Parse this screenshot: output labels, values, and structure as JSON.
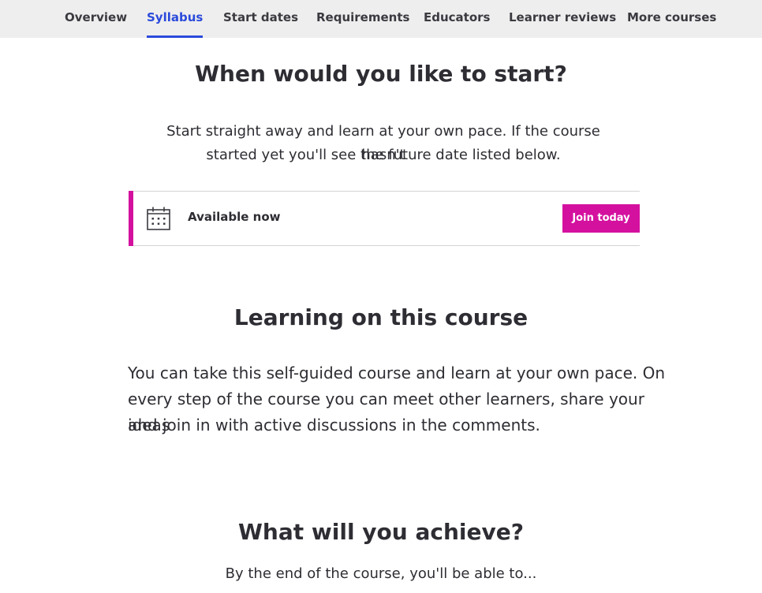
{
  "nav": {
    "items": [
      {
        "label": "Overview",
        "active": false
      },
      {
        "label": "Syllabus",
        "active": true
      },
      {
        "label": "Start dates",
        "active": false
      },
      {
        "label": "Requirements",
        "active": false
      },
      {
        "label": "Educators",
        "active": false
      },
      {
        "label": "Learner reviews",
        "active": false
      },
      {
        "label": "More courses",
        "active": false
      }
    ]
  },
  "start_section": {
    "heading": "When would you like to start?",
    "intro_line1": "Start straight away and learn at your own pace. If the course hasn't",
    "intro_line2": "started yet you'll see the future date listed below.",
    "availability": "Available now",
    "join_label": "Join today",
    "icon": "calendar-icon"
  },
  "learning_section": {
    "heading": "Learning on this course",
    "line1": "You can take this self-guided course and learn at your own pace. On",
    "line2": "every step of the course you can meet other learners, share your ideas",
    "line3": "and join in with active discussions in the comments."
  },
  "achieve_section": {
    "heading": "What will you achieve?",
    "intro": "By the end of the course, you'll be able to..."
  },
  "colors": {
    "accent_pink": "#d4119f",
    "active_blue": "#2a4adb",
    "nav_bg": "#eeeeee",
    "text": "#2d2d33"
  }
}
